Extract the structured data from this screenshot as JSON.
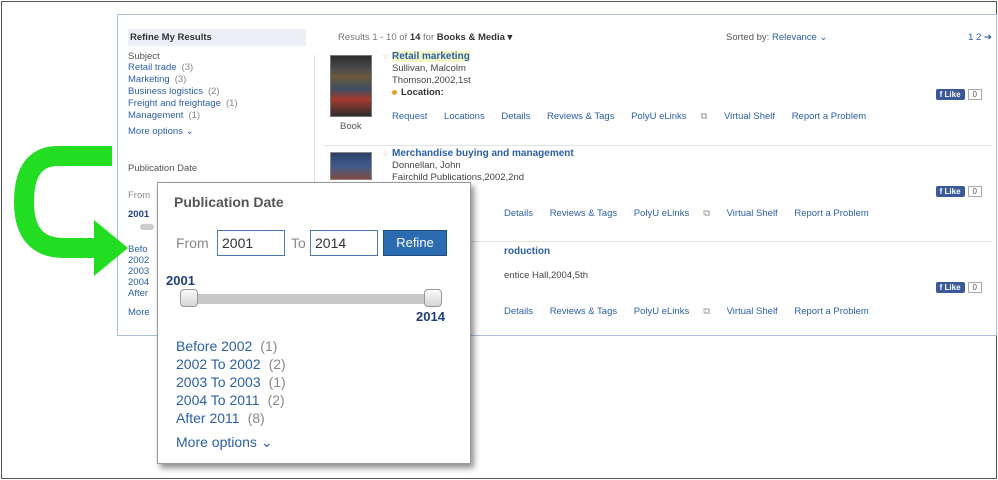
{
  "sidebar": {
    "heading": "Refine My Results",
    "subject_title": "Subject",
    "subjects": [
      {
        "label": "Retail trade",
        "count": "(3)"
      },
      {
        "label": "Marketing",
        "count": "(3)"
      },
      {
        "label": "Business logistics",
        "count": "(2)"
      },
      {
        "label": "Freight and freightage",
        "count": "(1)"
      },
      {
        "label": "Management",
        "count": "(1)"
      }
    ],
    "more_options": "More options",
    "pub_date_title": "Publication Date",
    "from_label": "From",
    "mini_year": "2001",
    "mini_list": [
      "Befo",
      "2002",
      "2003",
      "2004",
      "After"
    ],
    "mini_more": "More"
  },
  "results_bar": {
    "prefix": "Results 1 - 10 of",
    "total": "14",
    "for": "for",
    "scope": "Books & Media",
    "sorted_label": "Sorted by:",
    "sorted_value": "Relevance",
    "pages": "1 2"
  },
  "results": [
    {
      "title": "Retail marketing",
      "author": "Sullivan, Malcolm",
      "publisher": "Thomson,2002,1st",
      "location_label": "Location:",
      "type": "Book",
      "actions": [
        "Request",
        "Locations",
        "Details",
        "Reviews & Tags",
        "PolyU eLinks",
        "Virtual Shelf",
        "Report a Problem"
      ]
    },
    {
      "title": "Merchandise buying and management",
      "author": "Donnellan, John",
      "publisher": "Fairchild Publications,2002,2nd",
      "actions": [
        "Details",
        "Reviews & Tags",
        "PolyU eLinks",
        "Virtual Shelf",
        "Report a Problem"
      ]
    },
    {
      "title": "roduction",
      "publisher": "entice Hall,2004,5th",
      "actions": [
        "Details",
        "Reviews & Tags",
        "PolyU eLinks",
        "Virtual Shelf",
        "Report a Problem"
      ]
    }
  ],
  "facebook": {
    "like_label": "Like",
    "count": "0"
  },
  "popup": {
    "title": "Publication Date",
    "from_label": "From",
    "from_value": "2001",
    "to_label": "To",
    "to_value": "2014",
    "refine_label": "Refine",
    "slider_min_label": "2001",
    "slider_max_label": "2014",
    "slider_range": {
      "min": 2001,
      "max": 2014,
      "selected_from": 2001,
      "selected_to": 2014
    },
    "ranges": [
      {
        "label": "Before 2002",
        "count": "(1)"
      },
      {
        "label": "2002 To 2002",
        "count": "(2)"
      },
      {
        "label": "2003 To 2003",
        "count": "(1)"
      },
      {
        "label": "2004 To 2011",
        "count": "(2)"
      },
      {
        "label": "After 2011",
        "count": "(8)"
      }
    ],
    "more_options": "More options"
  },
  "colors": {
    "link": "#2b5fa8",
    "arrow": "#22dd22",
    "refine_button": "#2b6cb0",
    "facebook": "#3b5998"
  },
  "icons": [
    "chevron-down-icon",
    "arrow-right-icon",
    "external-link-icon",
    "star-icon",
    "facebook-icon",
    "curved-arrow-icon"
  ]
}
